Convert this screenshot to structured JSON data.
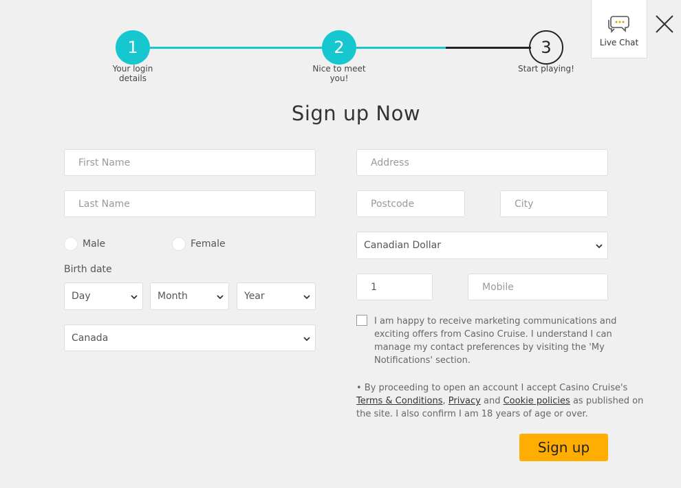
{
  "stepper": {
    "steps": [
      {
        "number": "1",
        "label_line1": "Your login",
        "label_line2": "details",
        "state": "done"
      },
      {
        "number": "2",
        "label_line1": "Nice to meet",
        "label_line2": "you!",
        "state": "done"
      },
      {
        "number": "3",
        "label_line1": "Start playing!",
        "label_line2": "",
        "state": "todo"
      }
    ],
    "colors": {
      "active": "#16c7cf",
      "inactive": "#222222"
    }
  },
  "live_chat": {
    "label": "Live Chat",
    "icon": "chat-bubbles-icon",
    "accent": "#e0a400"
  },
  "close": {
    "icon": "close-icon"
  },
  "title": "Sign up Now",
  "form": {
    "first_name": {
      "placeholder": "First Name",
      "value": ""
    },
    "last_name": {
      "placeholder": "Last Name",
      "value": ""
    },
    "gender": {
      "options": [
        "Male",
        "Female"
      ],
      "selected": null
    },
    "birth_date": {
      "label": "Birth date",
      "day": "Day",
      "month": "Month",
      "year": "Year"
    },
    "country": "Canada",
    "address": {
      "placeholder": "Address",
      "value": ""
    },
    "postcode": {
      "placeholder": "Postcode",
      "value": ""
    },
    "city": {
      "placeholder": "City",
      "value": ""
    },
    "currency": "Canadian Dollar",
    "phone_code": {
      "value": "1"
    },
    "mobile": {
      "placeholder": "Mobile",
      "value": ""
    },
    "marketing_consent": {
      "checked": false,
      "text": "I am happy to receive marketing communications and exciting offers from Casino Cruise. I understand I can manage my contact preferences by visiting the 'My Notifications' section."
    },
    "terms": {
      "prefix": "• By proceeding to open an account I accept Casino Cruise's",
      "link_terms": "Terms & Conditions",
      "link_privacy": "Privacy",
      "and": "and",
      "link_cookies": "Cookie policies",
      "suffix": "as published on the site. I also confirm I am 18 years of age or over."
    },
    "submit_label": "Sign up",
    "submit_color": "#ffad00"
  }
}
